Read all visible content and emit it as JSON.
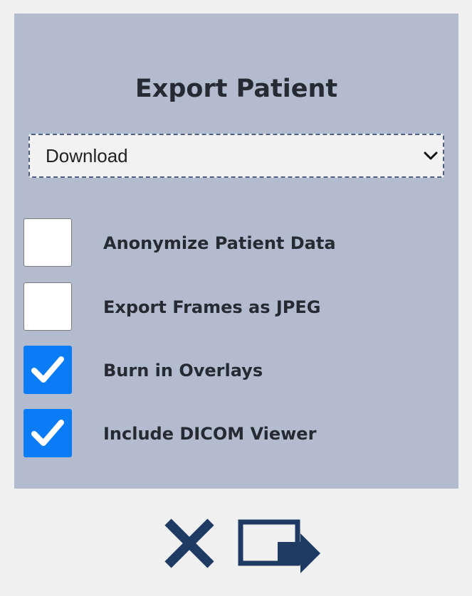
{
  "dialog": {
    "title": "Export Patient"
  },
  "export_target": {
    "selected": "Download"
  },
  "options": [
    {
      "label": "Anonymize Patient Data",
      "checked": false
    },
    {
      "label": "Export Frames as JPEG",
      "checked": false
    },
    {
      "label": "Burn in Overlays",
      "checked": true
    },
    {
      "label": "Include DICOM Viewer",
      "checked": true
    }
  ],
  "icons": {
    "cancel": "close-icon",
    "export": "export-icon",
    "checkmark": "checkmark-icon",
    "select": "chevron-down-icon"
  },
  "colors": {
    "panel": "#b3bccf",
    "checked": "#0a7cf5",
    "action": "#1f3a63"
  }
}
